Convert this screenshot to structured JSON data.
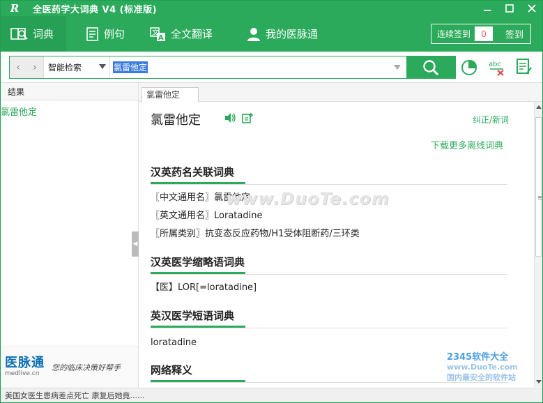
{
  "titlebar": {
    "app_title": "全医药学大词典  V4 (标准版)",
    "logo": "R"
  },
  "nav": {
    "tabs": [
      {
        "label": "词典",
        "icon": "book-search-icon"
      },
      {
        "label": "例句",
        "icon": "document-icon"
      },
      {
        "label": "全文翻译",
        "icon": "translate-icon"
      },
      {
        "label": "我的医脉通",
        "icon": "user-icon"
      }
    ],
    "checkin_label": "连续签到",
    "checkin_count": "0",
    "checkin_button": "签到"
  },
  "search": {
    "mode": "智能检索",
    "query": "氯雷他定"
  },
  "left": {
    "header": "结果",
    "results": [
      "氯雷他定"
    ],
    "ad_brand": "医脉通",
    "ad_domain": "medlive.cn",
    "ad_slogan": "您的临床决策好帮手"
  },
  "content": {
    "tab": "氯雷他定",
    "headword": "氯雷他定",
    "correct_link": "纠正/新词",
    "download_link": "下载更多离线词典",
    "sections": [
      {
        "title": "汉英药名关联词典",
        "entries": [
          "〖中文通用名〗氯雷他定",
          "〖英文通用名〗Loratadine",
          "〖所属类别〗抗变态反应药物/H1受体阻断药/三环类"
        ]
      },
      {
        "title": "汉英医学缩略语词典",
        "entries": [
          "【医】LOR[=loratadine]"
        ]
      },
      {
        "title": "英汉医学短语词典",
        "entries": [
          "loratadine"
        ]
      },
      {
        "title": "网络释义",
        "entries": []
      }
    ]
  },
  "status": {
    "text": "美国女医生患病差点死亡 康复后她竟......"
  },
  "watermark": {
    "text": "www.DuoTe.com",
    "brand": "2345软件大全",
    "url": "www.DuoTe.com",
    "caption": "国内最安全的软件站"
  },
  "colors": {
    "brand_green": "#2aaa5a"
  }
}
